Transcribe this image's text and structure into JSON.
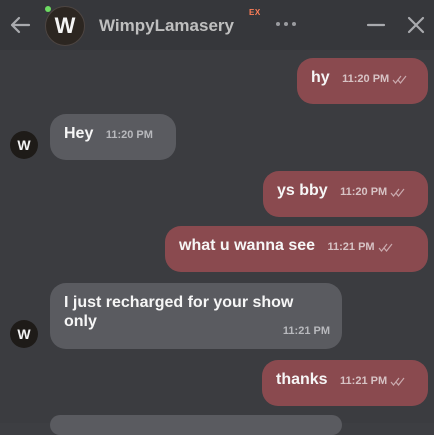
{
  "header": {
    "avatar_letter": "W",
    "contact_name": "WimpyLamasery",
    "badge": "EX",
    "back_icon": "arrow-left-icon",
    "more_icon": "more-horizontal-icon",
    "minimize_icon": "minimize-icon",
    "close_icon": "close-icon",
    "online": true
  },
  "messages": [
    {
      "direction": "out",
      "text": "hy",
      "time": "11:20 PM",
      "read": true
    },
    {
      "direction": "in",
      "text": "Hey",
      "time": "11:20 PM",
      "avatar_letter": "W"
    },
    {
      "direction": "out",
      "text": "ys bby",
      "time": "11:20 PM",
      "read": true
    },
    {
      "direction": "out",
      "text": "what u wanna see",
      "time": "11:21 PM",
      "read": true
    },
    {
      "direction": "in",
      "text": "I just recharged for your show only",
      "time": "11:21 PM",
      "avatar_letter": "W"
    },
    {
      "direction": "out",
      "text": "thanks",
      "time": "11:21 PM",
      "read": true
    }
  ],
  "colors": {
    "background": "#3b3c40",
    "header": "#36373b",
    "outgoing_bubble": "#8a4a4f",
    "incoming_bubble": "#5a5b60",
    "online": "#6ddc62",
    "badge": "#ff7f58"
  }
}
